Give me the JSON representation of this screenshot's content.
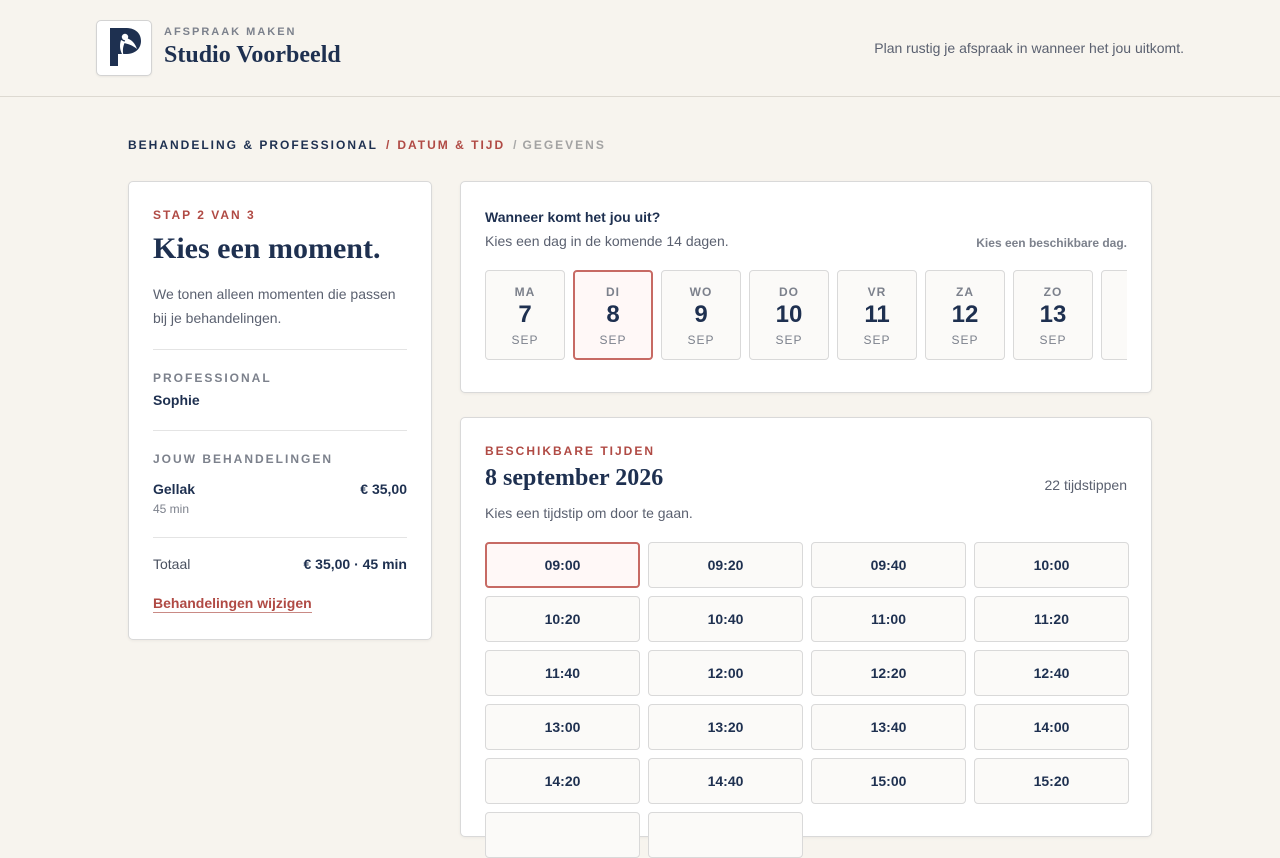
{
  "header": {
    "kicker": "AFSPRAAK MAKEN",
    "brand": "Studio Voorbeeld",
    "tagline": "Plan rustig je afspraak in wanneer het jou uitkomt."
  },
  "breadcrumb": {
    "step1": "BEHANDELING & PROFESSIONAL",
    "sep1": "/",
    "step2": "DATUM & TIJD",
    "sep2": "/",
    "step3": "GEGEVENS"
  },
  "sidebar": {
    "step": "STAP 2 VAN 3",
    "title": "Kies een moment.",
    "description": "We tonen alleen momenten die passen bij je behandelingen.",
    "professional_label": "PROFESSIONAL",
    "professional": "Sophie",
    "treatments_label": "JOUW BEHANDELINGEN",
    "treatment": {
      "name": "Gellak",
      "duration": "45 min",
      "price": "€ 35,00"
    },
    "total_label": "Totaal",
    "total_value": "€ 35,00 · 45 min",
    "edit_link": "Behandelingen wijzigen"
  },
  "date_picker": {
    "question": "Wanneer komt het jou uit?",
    "subtitle": "Kies een dag in de komende 14 dagen.",
    "hint": "Kies een beschikbare dag.",
    "days": [
      {
        "weekday": "MA",
        "day": "7",
        "month": "SEP"
      },
      {
        "weekday": "DI",
        "day": "8",
        "month": "SEP"
      },
      {
        "weekday": "WO",
        "day": "9",
        "month": "SEP"
      },
      {
        "weekday": "DO",
        "day": "10",
        "month": "SEP"
      },
      {
        "weekday": "VR",
        "day": "11",
        "month": "SEP"
      },
      {
        "weekday": "ZA",
        "day": "12",
        "month": "SEP"
      },
      {
        "weekday": "ZO",
        "day": "13",
        "month": "SEP"
      },
      {
        "weekday": "",
        "day": "",
        "month": ""
      }
    ],
    "selected_index": 1
  },
  "times": {
    "kicker": "BESCHIKBARE TIJDEN",
    "date": "8 september 2026",
    "count": "22 tijdstippen",
    "subtitle": "Kies een tijdstip om door te gaan.",
    "slots": [
      "09:00",
      "09:20",
      "09:40",
      "10:00",
      "10:20",
      "10:40",
      "11:00",
      "11:20",
      "11:40",
      "12:00",
      "12:20",
      "12:40",
      "13:00",
      "13:20",
      "13:40",
      "14:00",
      "14:20",
      "14:40",
      "15:00",
      "15:20",
      "",
      ""
    ],
    "selected_index": 0
  },
  "colors": {
    "accent": "#b04a44",
    "navy": "#1e3050",
    "background": "#f7f4ee"
  }
}
